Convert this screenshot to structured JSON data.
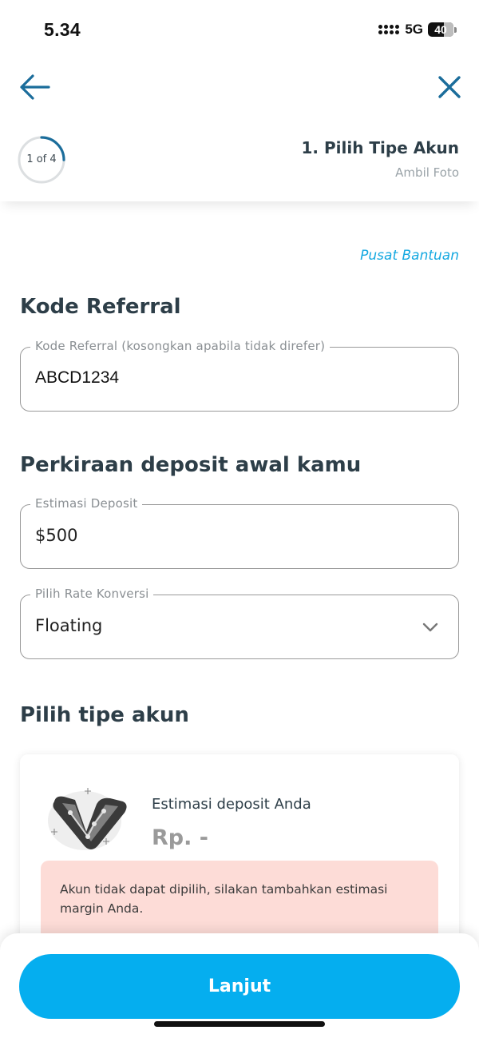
{
  "status_bar": {
    "time": "5.34",
    "network": "5G",
    "battery": "40"
  },
  "header": {
    "progress_text": "1 of 4",
    "progress_fraction": 0.25,
    "step_title": "1. Pilih Tipe Akun",
    "step_subtitle": "Ambil Foto",
    "back_icon": "arrow-left-icon",
    "close_icon": "close-icon"
  },
  "help_link": "Pusat Bantuan",
  "referral": {
    "section_title": "Kode Referral",
    "field_label": "Kode Referral (kosongkan apabila tidak direfer)",
    "field_value": "ABCD1234"
  },
  "deposit": {
    "section_title": "Perkiraan deposit awal kamu",
    "estimate_label": "Estimasi Deposit",
    "estimate_value": "$500",
    "rate_label": "Pilih Rate Konversi",
    "rate_value": "Floating"
  },
  "account_type": {
    "section_title": "Pilih tipe akun",
    "card": {
      "deposit_label": "Estimasi deposit Anda",
      "deposit_value": "Rp. -",
      "warning": "Akun tidak dapat dipilih, silakan tambahkan estimasi margin Anda."
    }
  },
  "footer": {
    "continue_label": "Lanjut"
  },
  "colors": {
    "accent": "#05aeef",
    "link": "#16a9e1",
    "warning_bg": "#fddcd7",
    "progress": "#1b6d9b"
  }
}
